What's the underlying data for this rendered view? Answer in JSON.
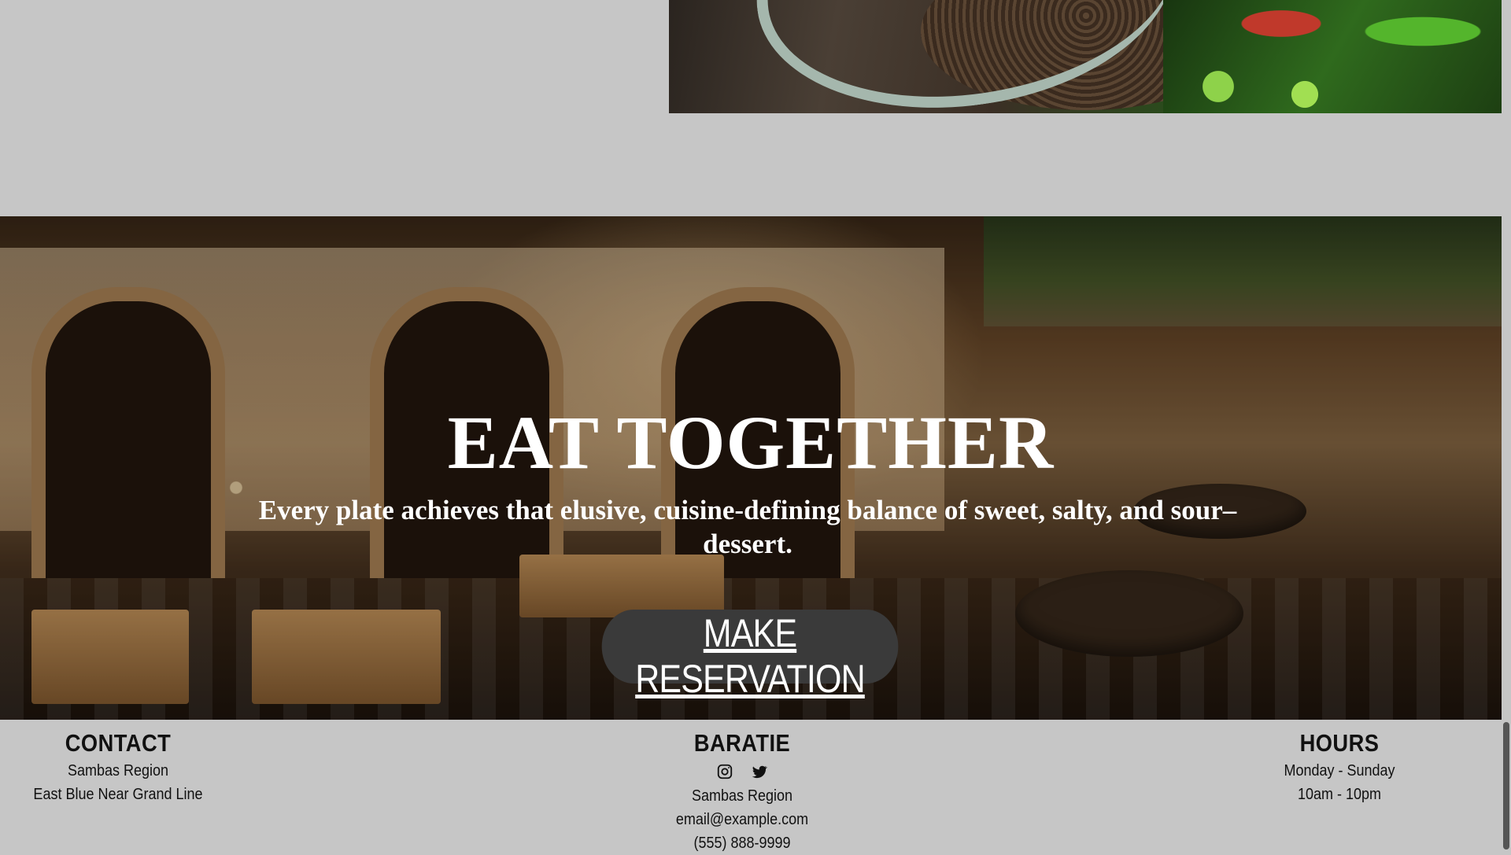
{
  "hero": {
    "title": "EAT TOGETHER",
    "subtitle": "Every plate achieves that elusive, cuisine-defining balance of sweet, salty, and sour–dessert.",
    "cta_label": "MAKE RESERVATION"
  },
  "footer": {
    "contact": {
      "heading": "CONTACT",
      "line1": "Sambas Region",
      "line2": "East Blue Near Grand Line"
    },
    "brand": {
      "heading": "BARATIE",
      "social_icons": [
        "instagram-icon",
        "twitter-icon"
      ],
      "address": "Sambas Region",
      "email": "email@example.com",
      "phone": "(555) 888-9999"
    },
    "hours": {
      "heading": "HOURS",
      "days": "Monday - Sunday",
      "time": "10am - 10pm"
    }
  },
  "colors": {
    "page_bg": "#c6c6c6",
    "button_bg": "#3a3a3a",
    "hero_text": "#ffffff"
  }
}
